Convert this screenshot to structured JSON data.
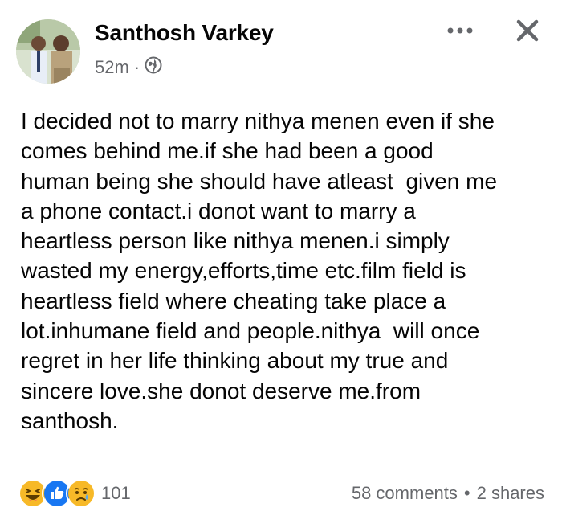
{
  "post": {
    "author": "Santhosh Varkey",
    "time": "52m",
    "separator": "·",
    "audience_icon": "globe-icon",
    "body": "I decided not to marry nithya menen even if she\ncomes behind me.if she had been a good\nhuman being she should have atleast  given me\na phone contact.i donot want to marry a\nheartless person like nithya menen.i simply\nwasted my energy,efforts,time etc.film field is\nheartless field where cheating take place a\nlot.inhumane field and people.nithya  will once\nregret in her life thinking about my true and\nsincere love.she donot deserve me.from\nsanthosh."
  },
  "header_actions": {
    "more_icon": "more-horizontal-icon",
    "close_icon": "close-icon"
  },
  "footer": {
    "reaction_icons": [
      "haha-reaction-icon",
      "like-reaction-icon",
      "sad-reaction-icon"
    ],
    "reaction_count": "101",
    "comments": "58 comments",
    "separator": "•",
    "shares": "2 shares"
  },
  "colors": {
    "text_primary": "#050505",
    "text_secondary": "#65676b",
    "like_blue": "#1877f2",
    "emoji_yellow": "#f7b928"
  }
}
